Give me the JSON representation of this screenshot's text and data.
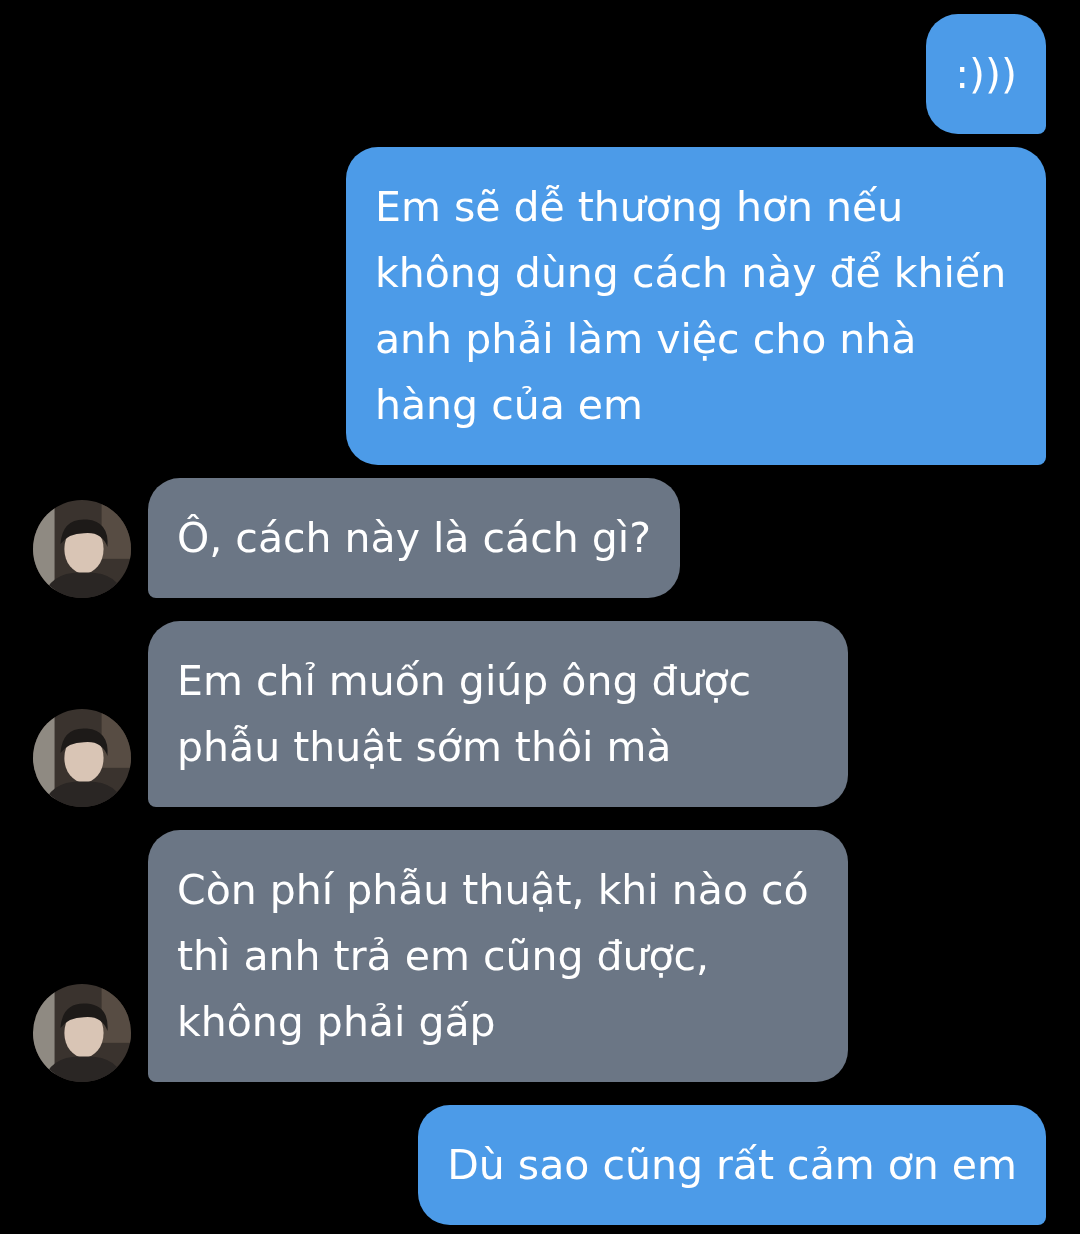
{
  "messages": [
    {
      "kind": "sent",
      "text": ":)))"
    },
    {
      "kind": "sent",
      "text": "Em sẽ dễ thương hơn nếu không dùng cách này để khiến anh phải làm việc cho nhà hàng của em"
    },
    {
      "kind": "received",
      "text": "Ô, cách này là cách gì?"
    },
    {
      "kind": "received",
      "text": "Em chỉ muốn giúp ông được phẫu thuật sớm thôi mà"
    },
    {
      "kind": "received",
      "text": "Còn phí phẫu thuật, khi nào có thì anh trả em cũng được, không phải gấp"
    },
    {
      "kind": "sent",
      "text": "Dù sao cũng rất cảm ơn em"
    }
  ]
}
